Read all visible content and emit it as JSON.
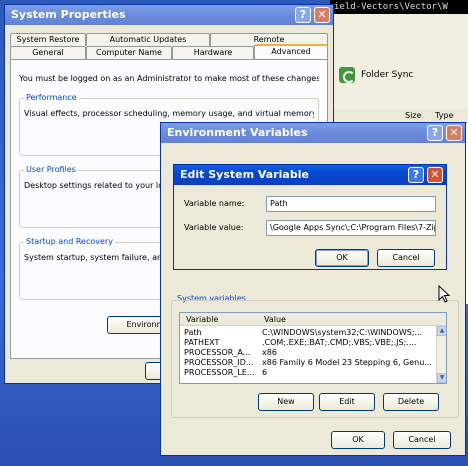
{
  "console": {
    "text": "ield-Vectors\\Vector\\W"
  },
  "explorer": {
    "folder_sync_label": "Folder Sync",
    "col_size": "Size",
    "col_type": "Type"
  },
  "system_properties": {
    "title": "System Properties",
    "tabs_top": [
      "System Restore",
      "Automatic Updates",
      "Remote"
    ],
    "tabs_bottom": [
      "General",
      "Computer Name",
      "Hardware",
      "Advanced"
    ],
    "admin_note": "You must be logged on as an Administrator to make most of these changes.",
    "performance": {
      "title": "Performance",
      "desc": "Visual effects, processor scheduling, memory usage, and virtual memory"
    },
    "user_profiles": {
      "title": "User Profiles",
      "desc": "Desktop settings related to your lo"
    },
    "startup": {
      "title": "Startup and Recovery",
      "desc": "System startup, system failure, and"
    },
    "env_button": "Environment"
  },
  "env_vars": {
    "title": "Environment Variables",
    "system_variables_label": "System variables",
    "columns": [
      "Variable",
      "Value"
    ],
    "rows": [
      {
        "variable": "Path",
        "value": "C:\\WINDOWS\\system32;C:\\WINDOWS;..."
      },
      {
        "variable": "PATHEXT",
        "value": ".COM;.EXE;.BAT;.CMD;.VBS;.VBE;.JS;...."
      },
      {
        "variable": "PROCESSOR_A...",
        "value": "x86"
      },
      {
        "variable": "PROCESSOR_ID...",
        "value": "x86 Family 6 Model 23 Stepping 6, Genu..."
      },
      {
        "variable": "PROCESSOR_LE...",
        "value": "6"
      }
    ],
    "new_label": "New",
    "edit_label": "Edit",
    "delete_label": "Delete",
    "ok_label": "OK",
    "cancel_label": "Cancel"
  },
  "edit_var": {
    "title": "Edit System Variable",
    "name_label": "Variable name:",
    "name_value": "Path",
    "value_label": "Variable value:",
    "value_value": "\\Google Apps Sync\\;C:\\Program Files\\7-Zip",
    "ok_label": "OK",
    "cancel_label": "Cancel"
  }
}
